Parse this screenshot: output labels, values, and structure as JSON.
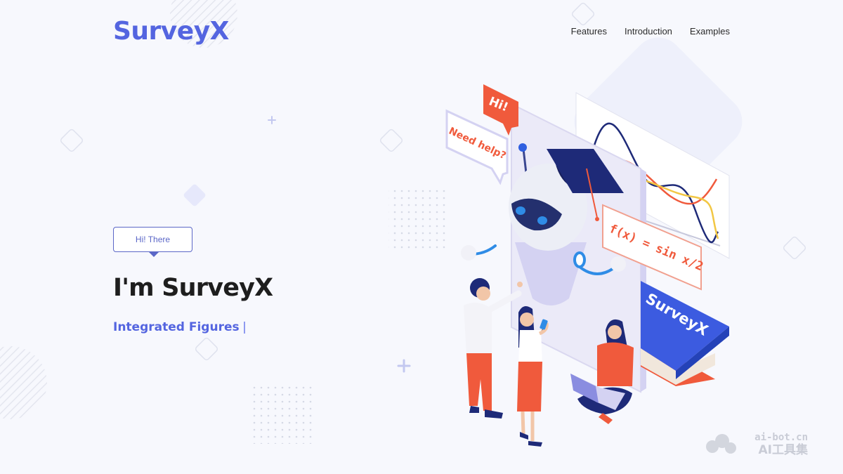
{
  "header": {
    "logo": "SurveyX",
    "nav": [
      "Features",
      "Introduction",
      "Examples"
    ]
  },
  "hero": {
    "tag": "Hi! There",
    "title": "I'm SurveyX",
    "subtitle": "Integrated Figures"
  },
  "illustration": {
    "bubble_hi": "Hi!",
    "bubble_help": "Need help?",
    "formula": "f(x) = sin x/2",
    "book_title": "SurveyX"
  },
  "watermark": {
    "domain": "ai-bot.cn",
    "name": "AI工具集"
  },
  "colors": {
    "brand": "#5465e0",
    "accent_red": "#f05a3c",
    "navy": "#1e2a78",
    "lavender": "#d4d2f2"
  }
}
